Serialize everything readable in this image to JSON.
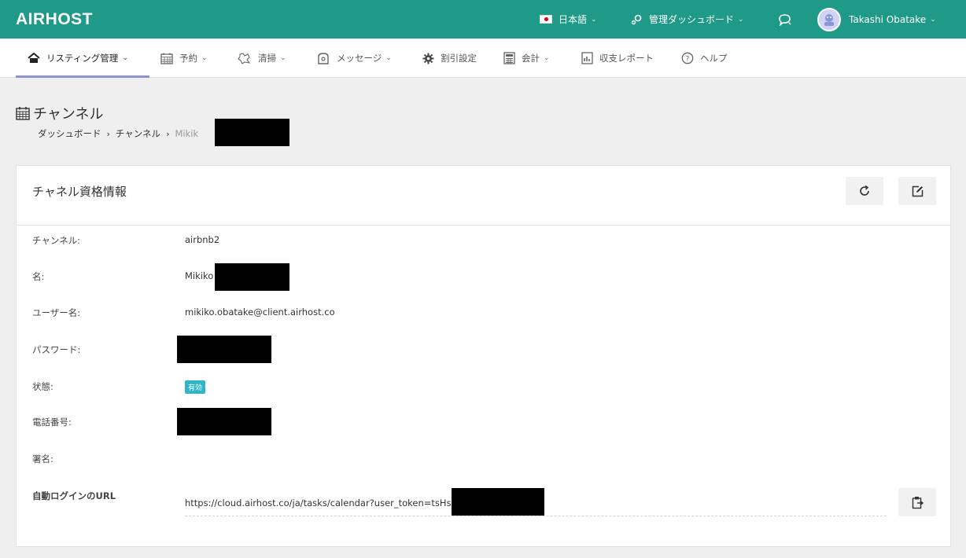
{
  "app": {
    "logo": "AIRHOST"
  },
  "topbar": {
    "language": "日本語",
    "dashboard": "管理ダッシュボード",
    "user_name": "Takashi Obatake"
  },
  "nav": {
    "items": [
      {
        "label": "リスティング管理",
        "icon": "home-icon",
        "dropdown": true,
        "active": true
      },
      {
        "label": "予約",
        "icon": "calendar-icon",
        "dropdown": true
      },
      {
        "label": "清掃",
        "icon": "cleaning-icon",
        "dropdown": true
      },
      {
        "label": "メッセージ",
        "icon": "message-icon",
        "dropdown": true
      },
      {
        "label": "割引設定",
        "icon": "gear-icon",
        "dropdown": false
      },
      {
        "label": "会計",
        "icon": "calculator-icon",
        "dropdown": true
      },
      {
        "label": "収支レポート",
        "icon": "report-icon",
        "dropdown": false
      },
      {
        "label": "ヘルプ",
        "icon": "help-icon",
        "dropdown": false
      }
    ]
  },
  "page": {
    "title": "チャンネル",
    "breadcrumb": [
      "ダッシュボード",
      "チャンネル",
      "Mikik"
    ]
  },
  "card": {
    "title": "チャネル資格情報",
    "rows": {
      "channel": {
        "label": "チャンネル:",
        "value": "airbnb2"
      },
      "name": {
        "label": "名:",
        "value": "Mikiko"
      },
      "username": {
        "label": "ユーザー名:",
        "value": "mikiko.obatake@client.airhost.co"
      },
      "password": {
        "label": "パスワード:"
      },
      "status": {
        "label": "状態:",
        "value": "有効"
      },
      "phone": {
        "label": "電話番号:"
      },
      "signature": {
        "label": "署名:"
      },
      "autologin": {
        "label": "自動ログインのURL",
        "value": "https://cloud.airhost.co/ja/tasks/calendar?user_token=tsHsl"
      }
    }
  },
  "colors": {
    "topbar": "#1f9a88",
    "nav_active_underline": "#8c96c8",
    "status_badge": "#2fb5c9"
  }
}
